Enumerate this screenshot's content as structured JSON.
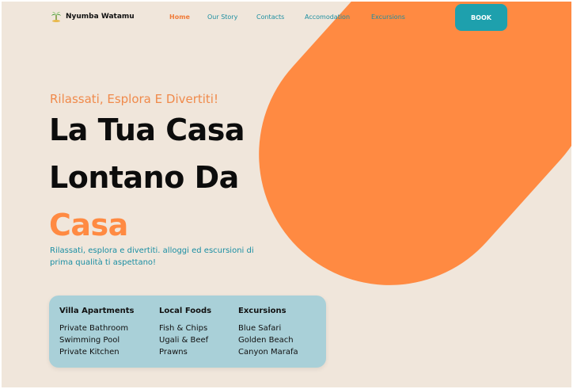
{
  "brand": {
    "name": "Nyumba Watamu",
    "logo_icon": "palm-tree-island-icon"
  },
  "nav": {
    "links": [
      {
        "label": "Home",
        "active": true
      },
      {
        "label": "Our Story",
        "active": false
      },
      {
        "label": "Contacts",
        "active": false
      },
      {
        "label": "Accomodation",
        "active": false
      },
      {
        "label": "Excursions",
        "active": false
      }
    ],
    "book_label": "BOOK"
  },
  "hero": {
    "tagline": "Rilassati, Esplora E Divertiti!",
    "headline_line1": "La Tua Casa",
    "headline_line2": "Lontano Da",
    "headline_accent": "Casa",
    "subtext": "Rilassati, esplora e divertiti. alloggi ed escursioni di prima qualità ti aspettano!"
  },
  "features": [
    {
      "title": "Villa Apartments",
      "items": [
        "Private Bathroom",
        "Swimming Pool",
        "Private Kitchen"
      ]
    },
    {
      "title": "Local Foods",
      "items": [
        "Fish & Chips",
        "Ugali & Beef",
        "Prawns"
      ]
    },
    {
      "title": "Excursions",
      "items": [
        "Blue Safari",
        "Golden Beach",
        "Canyon Marafa"
      ]
    }
  ],
  "colors": {
    "background": "#f0e6db",
    "accent_orange": "#ff8a42",
    "teal": "#1ea0ad",
    "card_blue": "#a9d0d8",
    "text_dark": "#0c0c0c"
  }
}
